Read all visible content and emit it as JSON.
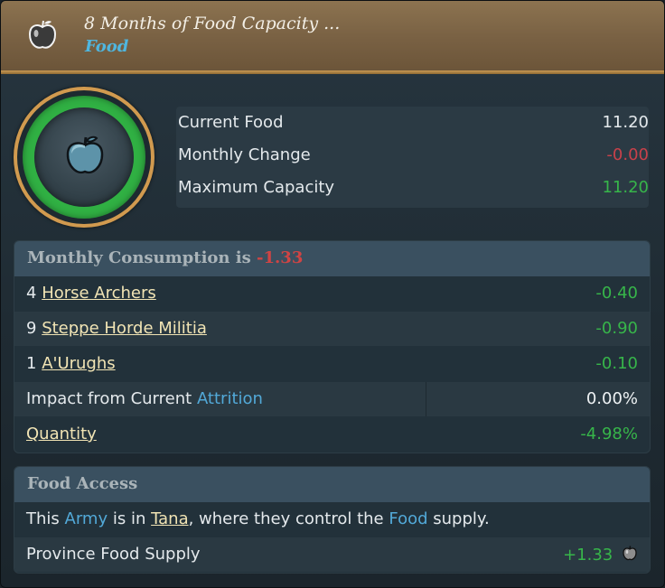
{
  "header": {
    "title": "8 Months of Food Capacity ...",
    "subtitle": "Food",
    "icon": "apple-icon"
  },
  "gauge": {
    "icon": "apple-icon",
    "fill_fraction": 1.0,
    "ring_color": "#30b043"
  },
  "stats": [
    {
      "label": "Current Food",
      "value": "11.20",
      "color": "#e4e9ec"
    },
    {
      "label": "Monthly Change",
      "value": "-0.00",
      "color": "#c8414a"
    },
    {
      "label": "Maximum Capacity",
      "value": "11.20",
      "color": "#37b54a"
    }
  ],
  "consumption": {
    "title_prefix": "Monthly Consumption is",
    "title_value": "-1.33",
    "rows": [
      {
        "count": "4",
        "name": "Horse Archers",
        "value": "-0.40"
      },
      {
        "count": "9",
        "name": "Steppe Horde Militia",
        "value": "-0.90"
      },
      {
        "count": "1",
        "name": "A'Urughs",
        "value": "-0.10"
      }
    ],
    "attrition": {
      "prefix": "Impact from Current",
      "link": "Attrition",
      "value": "0.00%"
    },
    "quantity": {
      "label": "Quantity",
      "value": "-4.98%"
    }
  },
  "access": {
    "title": "Food Access",
    "sentence": {
      "p1": "This",
      "army": "Army",
      "p2": "is in",
      "province": "Tana",
      "p3": ", where they control the",
      "food": "Food",
      "p4": "supply."
    },
    "supply": {
      "label": "Province Food Supply",
      "value": "+1.33",
      "icon": "apple-icon"
    }
  },
  "colors": {
    "positive": "#37b54a",
    "negative": "#d04444",
    "link_blue": "#52a9d8",
    "link_cream": "#f1e4b4"
  }
}
